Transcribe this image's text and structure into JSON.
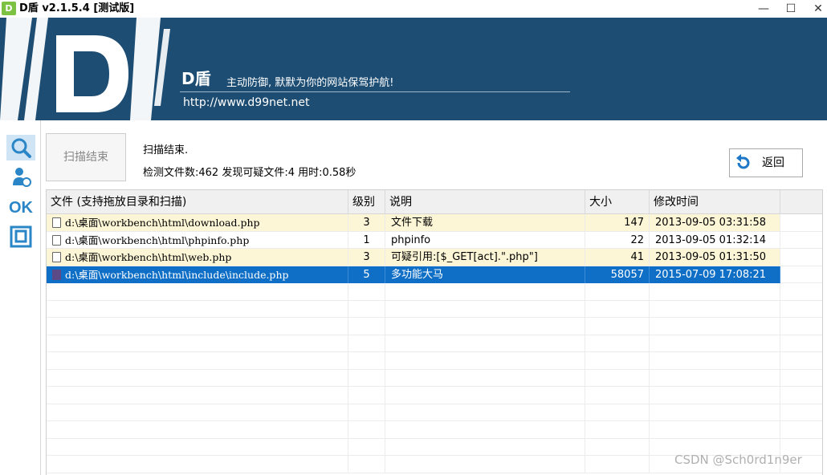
{
  "window": {
    "title": "D盾 v2.1.5.4 [测试版]",
    "logo_text": "D",
    "minimize_icon": "minimize-icon",
    "maximize_icon": "maximize-icon",
    "close_icon": "close-icon"
  },
  "banner": {
    "brand": "D盾",
    "slogan": "主动防御, 默默为你的网站保驾护航!",
    "url": "http://www.d99net.net",
    "colors": {
      "background": "#1d4d73"
    }
  },
  "toolstrip": {
    "items": [
      {
        "icon": "search-icon",
        "active": true
      },
      {
        "icon": "user-tool-icon",
        "active": false
      },
      {
        "icon": "ok-icon",
        "label": "OK",
        "active": false
      },
      {
        "icon": "frame-icon",
        "active": false
      }
    ]
  },
  "scan": {
    "button_label": "扫描结束",
    "status_line1": "扫描结束.",
    "status_line2": "检测文件数:462 发现可疑文件:4 用时:0.58秒",
    "back_label": "返回"
  },
  "table": {
    "headers": {
      "file": "文件 (支持拖放目录和扫描)",
      "level": "级别",
      "desc": "说明",
      "size": "大小",
      "time": "修改时间"
    },
    "rows": [
      {
        "file": "d:\\桌面\\workbench\\html\\download.php",
        "level": "3",
        "desc": "文件下载",
        "size": "147",
        "time": "2013-09-05 03:31:58",
        "style": "warn"
      },
      {
        "file": "d:\\桌面\\workbench\\html\\phpinfo.php",
        "level": "1",
        "desc": "phpinfo",
        "size": "22",
        "time": "2013-09-05 01:32:14",
        "style": "normal"
      },
      {
        "file": "d:\\桌面\\workbench\\html\\web.php",
        "level": "3",
        "desc": "可疑引用:[$_GET[act].\".php\"]",
        "size": "41",
        "time": "2013-09-05 01:31:50",
        "style": "warn"
      },
      {
        "file": "d:\\桌面\\workbench\\html\\include\\include.php",
        "level": "5",
        "desc": "多功能大马",
        "size": "58057",
        "time": "2015-07-09 17:08:21",
        "style": "selected"
      }
    ],
    "colors": {
      "warn_row": "#fcf6d6",
      "selected_row": "#0f6fc6"
    }
  },
  "watermark": "CSDN @Sch0rd1n9er"
}
